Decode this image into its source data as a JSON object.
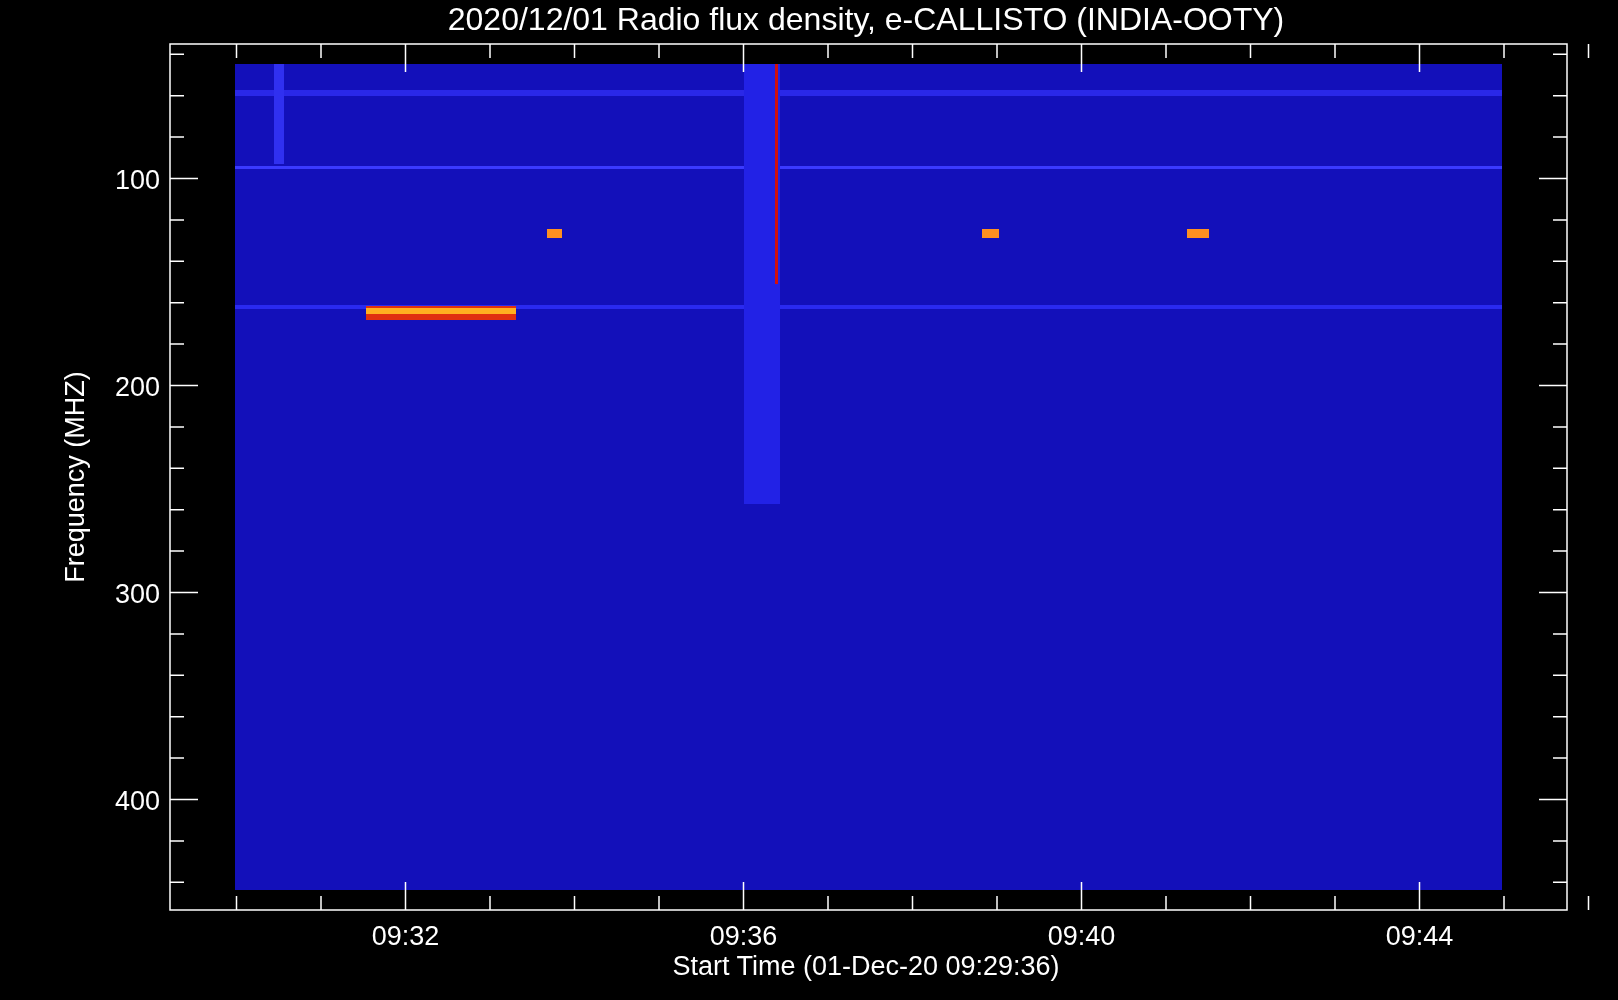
{
  "title": "2020/12/01  Radio flux density, e-CALLISTO (INDIA-OOTY)",
  "y_axis": {
    "label": "Frequency (MHZ)",
    "ticks": [
      "100",
      "200",
      "300",
      "400"
    ]
  },
  "x_axis": {
    "label": "Start Time (01-Dec-20 09:29:36)",
    "ticks": [
      "09:32",
      "09:36",
      "09:40",
      "09:44"
    ]
  }
}
